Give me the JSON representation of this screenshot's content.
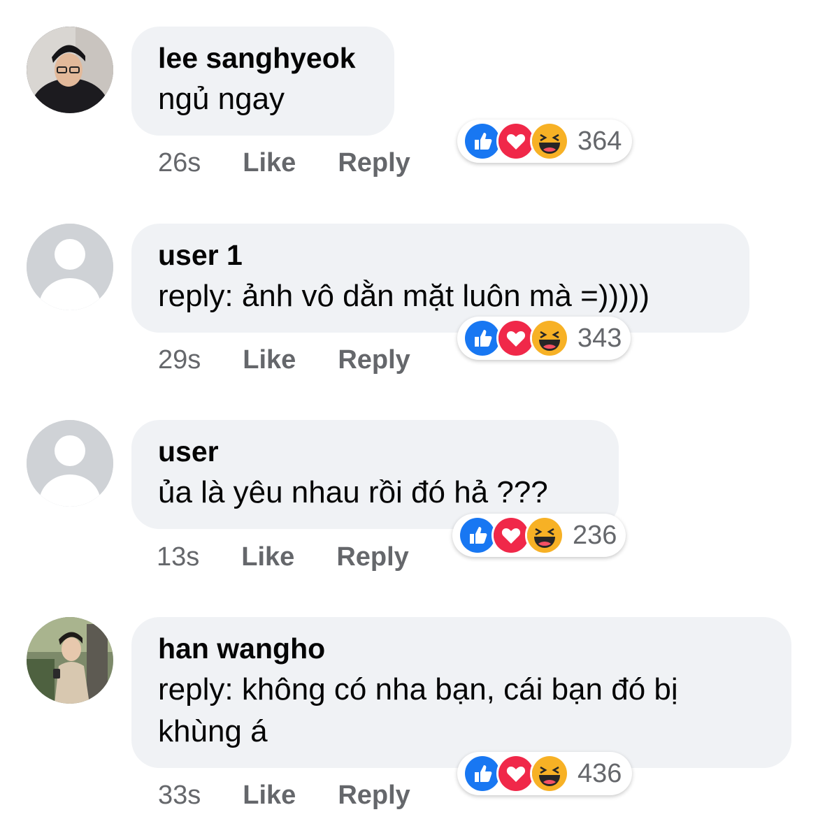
{
  "comments": [
    {
      "name": "lee sanghyeok",
      "text": "ngủ ngay",
      "time": "26s",
      "like_label": "Like",
      "reply_label": "Reply",
      "reaction_count": "364",
      "avatar": "photo-avatar-dark"
    },
    {
      "name": "user 1",
      "text": "reply: ảnh vô dằn mặt luôn mà =)))))",
      "time": "29s",
      "like_label": "Like",
      "reply_label": "Reply",
      "reaction_count": "343",
      "avatar": "default-avatar"
    },
    {
      "name": "user",
      "text": "ủa là yêu nhau rồi đó hả ???",
      "time": "13s",
      "like_label": "Like",
      "reply_label": "Reply",
      "reaction_count": "236",
      "avatar": "default-avatar"
    },
    {
      "name": "han wangho",
      "text": "reply: không có nha bạn, cái bạn đó bị khùng á",
      "time": "33s",
      "like_label": "Like",
      "reply_label": "Reply",
      "reaction_count": "436",
      "avatar": "photo-avatar-outdoor"
    }
  ],
  "reaction_icons": [
    "like-icon",
    "love-icon",
    "haha-icon"
  ],
  "colors": {
    "bubble": "#f0f2f5",
    "meta_text": "#65676b",
    "like_blue": "#1877f2",
    "love_red": "#f02849",
    "haha_yellow": "#f7b125"
  }
}
